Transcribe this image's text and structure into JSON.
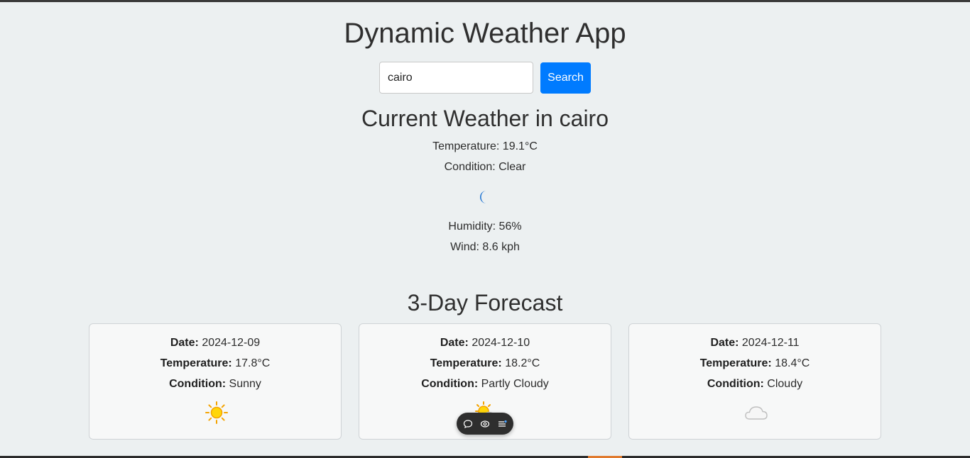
{
  "app": {
    "title": "Dynamic Weather App"
  },
  "search": {
    "value": "cairo",
    "button_label": "Search"
  },
  "current": {
    "heading": "Current Weather in cairo",
    "temperature": "Temperature: 19.1°C",
    "condition": "Condition: Clear",
    "icon": "moon-icon",
    "humidity": "Humidity: 56%",
    "wind": "Wind: 8.6 kph"
  },
  "forecast": {
    "heading": "3-Day Forecast",
    "date_label": "Date:",
    "temp_label": "Temperature:",
    "condition_label": "Condition:",
    "days": [
      {
        "date": "2024-12-09",
        "temperature": "17.8°C",
        "condition": "Sunny",
        "icon": "sun-icon"
      },
      {
        "date": "2024-12-10",
        "temperature": "18.2°C",
        "condition": "Partly Cloudy",
        "icon": "partly-cloudy-icon"
      },
      {
        "date": "2024-12-11",
        "temperature": "18.4°C",
        "condition": "Cloudy",
        "icon": "cloud-icon"
      }
    ]
  },
  "toolbar": {
    "items": [
      "chat-icon",
      "eye-icon",
      "menu-icon"
    ]
  },
  "colors": {
    "background": "#ecf0f1",
    "accent": "#007bff",
    "moon": "#1e73d2",
    "sun": "#f5c400"
  }
}
